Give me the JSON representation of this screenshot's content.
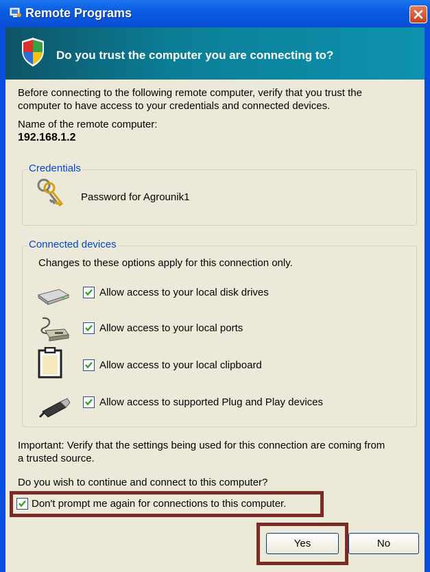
{
  "window": {
    "title": "Remote Programs"
  },
  "banner": {
    "question": "Do you trust the computer you are connecting to?"
  },
  "intro": {
    "line1": "Before connecting to the following remote computer, verify that you trust the",
    "line2": "computer to have access to your credentials and connected devices."
  },
  "remote": {
    "label": "Name of the remote computer:",
    "value": "192.168.1.2"
  },
  "credentials": {
    "title": "Credentials",
    "item": "Password for Agrounik1"
  },
  "devices": {
    "title": "Connected devices",
    "note": "Changes to these options apply for this connection only.",
    "options": [
      {
        "label": "Allow access to your local disk drives",
        "icon": "disk-drive-icon",
        "checked": true
      },
      {
        "label": "Allow access to your local ports",
        "icon": "port-cable-icon",
        "checked": true
      },
      {
        "label": "Allow access to your local clipboard",
        "icon": "clipboard-icon",
        "checked": true
      },
      {
        "label": "Allow access to supported Plug and Play devices",
        "icon": "usb-plug-icon",
        "checked": true
      }
    ]
  },
  "important": {
    "line1": "Important: Verify that the settings being used for this connection are coming from",
    "line2": "a trusted source."
  },
  "question": "Do you wish to continue and connect to this computer?",
  "dont_prompt": {
    "label": "Don't prompt me again for connections to this computer.",
    "checked": true
  },
  "buttons": {
    "yes": "Yes",
    "no": "No"
  },
  "colors": {
    "titlebar": "#0a5adf",
    "banner": "#0b7e96",
    "dialog_bg": "#ece9d8",
    "group_title": "#0046d5",
    "highlight": "#7a2b25"
  }
}
